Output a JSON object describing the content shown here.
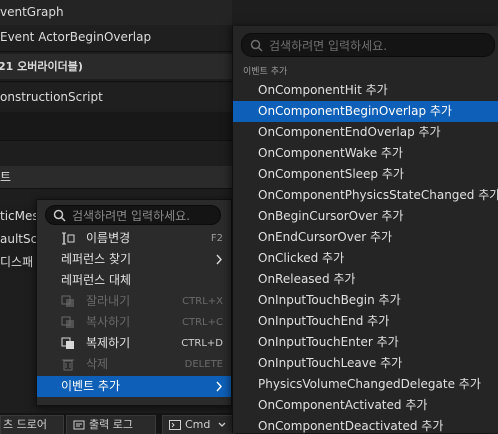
{
  "background": {
    "rows": [
      "ventGraph",
      "Event ActorBeginOverlap",
      "21 오버라이더블)",
      "onstructionScript",
      "",
      "트",
      "ticMes",
      "aultSc",
      "디스패"
    ]
  },
  "bottom_bar": {
    "buttons": [
      "츠 드로어",
      "출력 로그",
      "Cmd"
    ]
  },
  "context_menu": {
    "search_placeholder": "검색하려면 입력하세요.",
    "items": [
      {
        "label": "이름변경",
        "shortcut": "F2",
        "icon": "rename-icon",
        "disabled": false
      },
      {
        "label": "레퍼런스 찾기",
        "shortcut": "",
        "icon": "",
        "disabled": false,
        "submenu": true
      },
      {
        "label": "레퍼런스 대체",
        "shortcut": "",
        "icon": "",
        "disabled": false
      },
      {
        "label": "잘라내기",
        "shortcut": "CTRL+X",
        "icon": "cut-icon",
        "disabled": true
      },
      {
        "label": "복사하기",
        "shortcut": "CTRL+C",
        "icon": "copy-icon",
        "disabled": true
      },
      {
        "label": "복제하기",
        "shortcut": "CTRL+D",
        "icon": "duplicate-icon",
        "disabled": false
      },
      {
        "label": "삭제",
        "shortcut": "DELETE",
        "icon": "delete-icon",
        "disabled": true
      },
      {
        "label": "이벤트 추가",
        "shortcut": "",
        "icon": "",
        "disabled": false,
        "submenu": true,
        "selected": true
      }
    ]
  },
  "submenu": {
    "search_placeholder": "검색하려면 입력하세요.",
    "header": "이벤트 추가",
    "selected_index": 1,
    "items": [
      "OnComponentHit 추가",
      "OnComponentBeginOverlap 추가",
      "OnComponentEndOverlap 추가",
      "OnComponentWake 추가",
      "OnComponentSleep 추가",
      "OnComponentPhysicsStateChanged 추가",
      "OnBeginCursorOver 추가",
      "OnEndCursorOver 추가",
      "OnClicked 추가",
      "OnReleased 추가",
      "OnInputTouchBegin 추가",
      "OnInputTouchEnd 추가",
      "OnInputTouchEnter 추가",
      "OnInputTouchLeave 추가",
      "PhysicsVolumeChangedDelegate 추가",
      "OnComponentActivated 추가",
      "OnComponentDeactivated 추가"
    ]
  },
  "colors": {
    "selection": "#0d5fb8",
    "menu_bg": "#2b2b2b",
    "submenu_bg": "#252525"
  }
}
